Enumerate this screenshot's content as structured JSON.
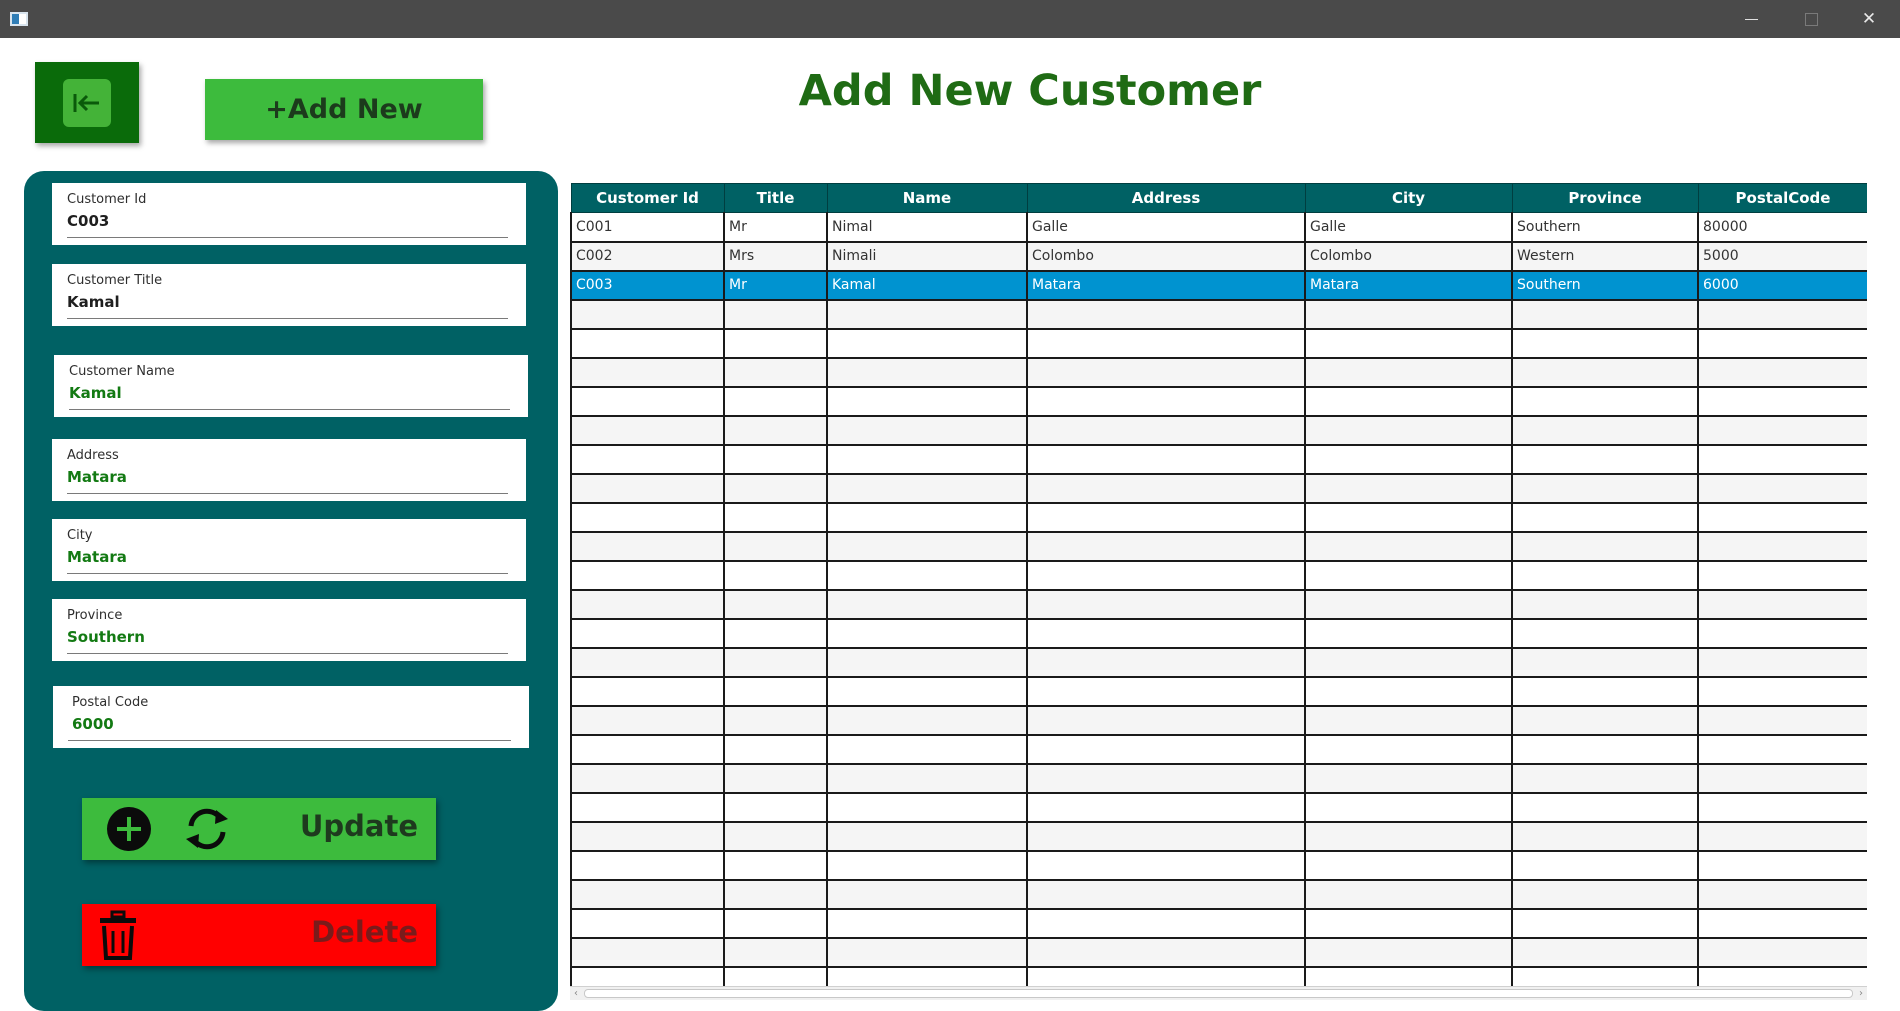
{
  "window": {
    "close_glyph": "✕"
  },
  "header": {
    "add_new_label": "+Add New",
    "title": "Add New Customer"
  },
  "form": {
    "fields": [
      {
        "label": "Customer Id",
        "value": "C003"
      },
      {
        "label": "Customer Title",
        "value": "Kamal"
      },
      {
        "label": "Customer Name",
        "value": "Kamal"
      },
      {
        "label": "Address",
        "value": "Matara"
      },
      {
        "label": "City",
        "value": "Matara"
      },
      {
        "label": "Province",
        "value": "Southern"
      },
      {
        "label": "Postal Code",
        "value": "6000"
      }
    ],
    "update_label": "Update",
    "delete_label": "Delete"
  },
  "table": {
    "columns": [
      "Customer Id",
      "Title",
      "Name",
      "Address",
      "City",
      "Province",
      "PostalCode"
    ],
    "rows": [
      [
        "C001",
        "Mr",
        "Nimal",
        "Galle",
        "Galle",
        "Southern",
        "80000"
      ],
      [
        "C002",
        "Mrs",
        "Nimali",
        "Colombo",
        "Colombo",
        "Western",
        "5000"
      ],
      [
        "C003",
        "Mr",
        "Kamal",
        "Matara",
        "Matara",
        "Southern",
        "6000"
      ]
    ],
    "selected_row": 2
  },
  "colors": {
    "panel": "#006164",
    "accent_green": "#3dbb3d",
    "title_green": "#1f6b14",
    "delete_red": "#ff0000",
    "selection_blue": "#0093d0"
  },
  "icons": {
    "back": "back-arrow-icon",
    "add": "plus-circle-icon",
    "update": "refresh-icon",
    "delete": "trash-icon"
  }
}
